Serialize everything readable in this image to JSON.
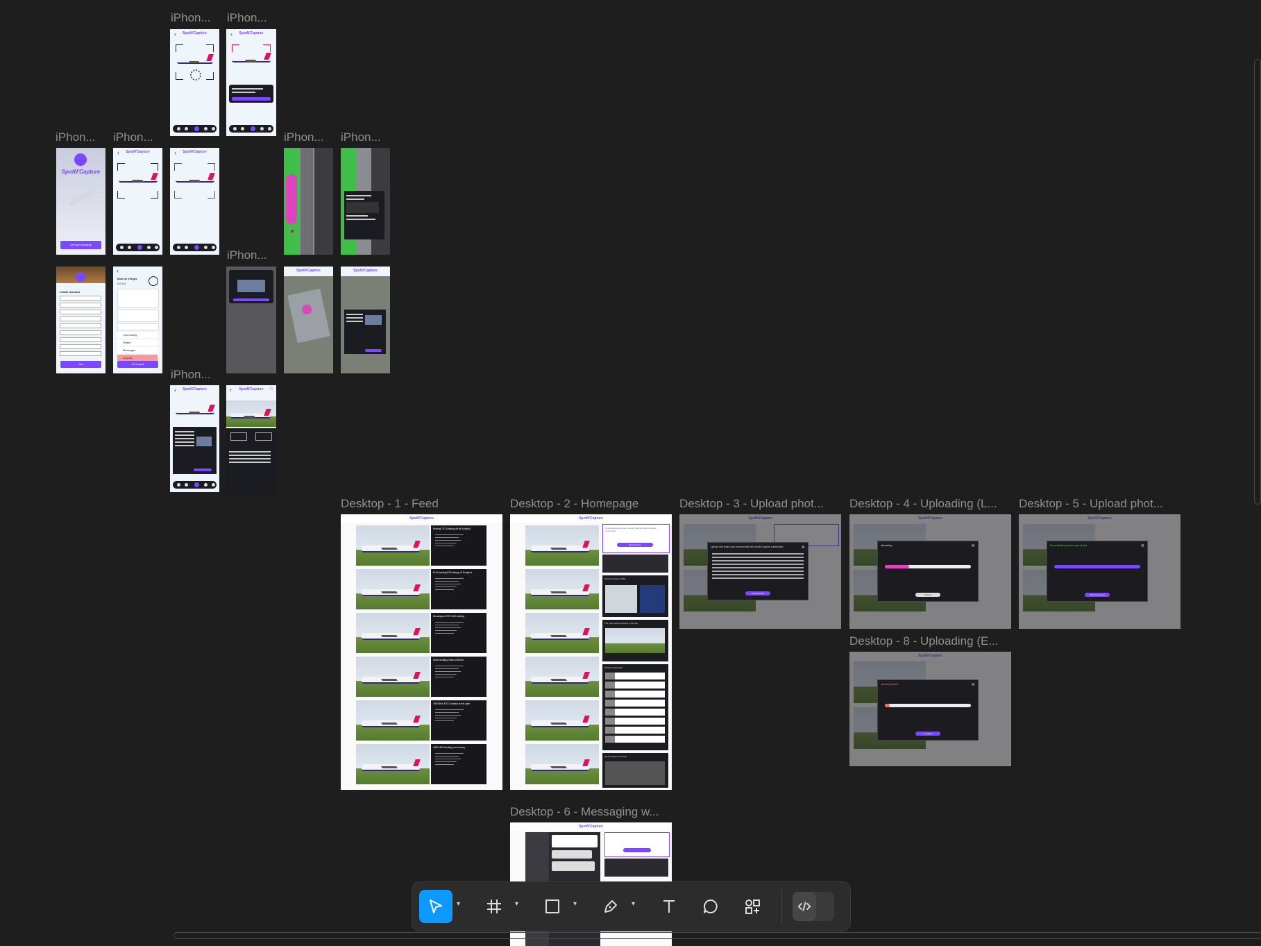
{
  "frame_labels": {
    "iphone_a": "iPhon...",
    "iphone_b": "iPhon...",
    "iphone_c": "iPhon...",
    "iphone_d": "iPhon...",
    "iphone_e": "iPhon...",
    "iphone_f": "iPhon...",
    "iphone_g": "iPhon...",
    "iphone_h": "iPhon...",
    "iphone_i": "iPhon...",
    "iphone_j": "iPhon...",
    "iphone_k": "iPhon...",
    "iphone_l": "iPhon...",
    "iphone_m": "iPhon...",
    "iphone_n": "iPhon...",
    "iphone_o": "iPhon...",
    "iphone_p": "iPhon...",
    "desktop_1": "Desktop - 1 - Feed",
    "desktop_2": "Desktop - 2 - Homepage",
    "desktop_3": "Desktop - 3 - Upload phot...",
    "desktop_4": "Desktop - 4 - Uploading (L...",
    "desktop_5": "Desktop - 5 - Upload phot...",
    "desktop_6": "Desktop - 6 - Messaging w...",
    "desktop_8": "Desktop - 8 - Uploading (E..."
  },
  "app": {
    "brand": "SpotN'Capture",
    "splash_title": "SpotN'Capture",
    "splash_button": "Let's get spotting!",
    "create_account": "Create account",
    "profile_name": "Mon de Vlieger",
    "profile_score": "4.6 5.0",
    "menu": [
      "Community",
      "Profile",
      "Messages",
      "Log out"
    ],
    "lets_spot": "Let's spot!",
    "join": "Join"
  },
  "feed": {
    "posts": [
      "Boeing 747-8 taking off at Schiphol",
      "KLM landing B24 taking off Schiphol",
      "Norwegian B737-800 landing",
      "Delta landing Delta A330neo",
      "TAROM's B737 parked at the gate",
      "A330-900 landing wet runway"
    ]
  },
  "homepage": {
    "upload_prompt": "Upload and share your moment with the SpotN'Capture community!",
    "upload_button": "Upload photo",
    "news_title": "Schiphol Airport (AMS)",
    "top_pictures": "The most viewed pictures of the day",
    "newsletter": "Schiphol Newsletter",
    "socials": "SpotN'Capture's Socials"
  },
  "uploads": {
    "upload_title": "Upload and share your moment with the SpotN'Capture community!",
    "upload_submit": "Upload photo",
    "uploading_title": "Uploading...",
    "uploading_cancel": "Cancel",
    "success_title": "Successfully uploaded your photo!",
    "success_button": "Check your feed",
    "failed_title": "Uploading failed...",
    "failed_button": "Try again"
  },
  "toolbar": {
    "tools": [
      "move-tool",
      "frame-tool",
      "shape-tool",
      "pen-tool",
      "text-tool",
      "comment-tool",
      "assets-tool",
      "dev-mode-toggle"
    ],
    "active": "move-tool"
  },
  "colors": {
    "canvas": "#1e1e1e",
    "accent": "#0d99ff",
    "brand_purple": "#7b47ff",
    "pink": "#e0105a"
  }
}
